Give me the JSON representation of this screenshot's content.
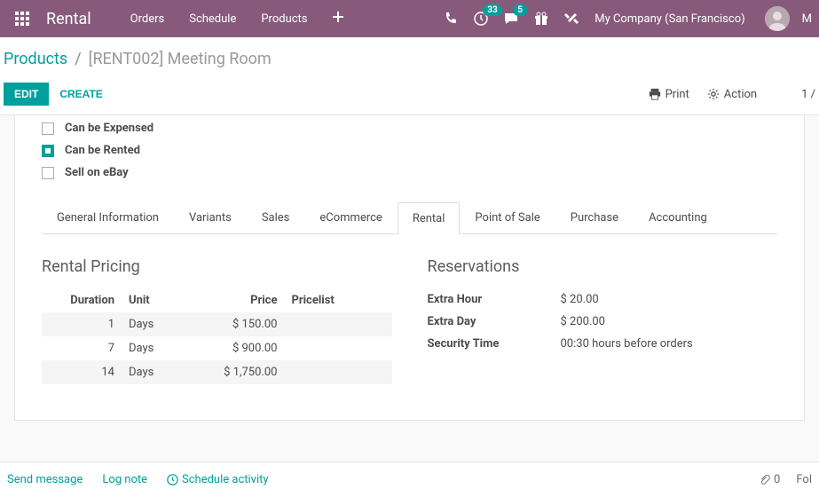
{
  "nav": {
    "app": "Rental",
    "items": [
      "Orders",
      "Schedule",
      "Products"
    ],
    "badge1": "33",
    "badge2": "5",
    "company": "My Company (San Francisco)"
  },
  "breadcrumb": {
    "root": "Products",
    "current": "[RENT002] Meeting Room"
  },
  "buttons": {
    "edit": "EDIT",
    "create": "CREATE",
    "print": "Print",
    "action": "Action",
    "pager": "1 /"
  },
  "checks": [
    {
      "label": "Can be Expensed",
      "checked": false
    },
    {
      "label": "Can be Rented",
      "checked": true
    },
    {
      "label": "Sell on eBay",
      "checked": false
    }
  ],
  "tabs": [
    "General Information",
    "Variants",
    "Sales",
    "eCommerce",
    "Rental",
    "Point of Sale",
    "Purchase",
    "Accounting"
  ],
  "pricing": {
    "title": "Rental Pricing",
    "headers": {
      "duration": "Duration",
      "unit": "Unit",
      "price": "Price",
      "pricelist": "Pricelist"
    },
    "rows": [
      {
        "duration": "1",
        "unit": "Days",
        "price": "$ 150.00"
      },
      {
        "duration": "7",
        "unit": "Days",
        "price": "$ 900.00"
      },
      {
        "duration": "14",
        "unit": "Days",
        "price": "$ 1,750.00"
      }
    ]
  },
  "reservations": {
    "title": "Reservations",
    "rows": [
      {
        "label": "Extra Hour",
        "value": "$ 20.00"
      },
      {
        "label": "Extra Day",
        "value": "$ 200.00"
      },
      {
        "label": "Security Time",
        "value": "00:30 hours before orders"
      }
    ]
  },
  "footer": {
    "send": "Send message",
    "log": "Log note",
    "schedule": "Schedule activity",
    "attach": "0",
    "follow": "Fol"
  }
}
